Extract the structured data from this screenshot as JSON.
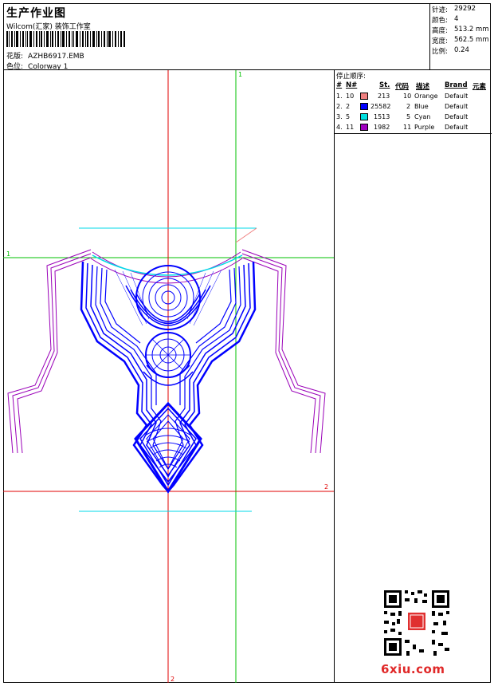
{
  "header": {
    "title": "生产作业图",
    "company": "Wilcom(汇家) 装饰工作室",
    "design_label": "花版:",
    "design_value": "AZHB6917.EMB",
    "colorway_label": "色位:",
    "colorway_value": "Colorway 1"
  },
  "stats": [
    {
      "label": "针迹:",
      "value": "29292"
    },
    {
      "label": "颜色:",
      "value": "4"
    },
    {
      "label": "高度:",
      "value": "513.2 mm"
    },
    {
      "label": "宽度:",
      "value": "562.5 mm"
    },
    {
      "label": "比例:",
      "value": "0.24"
    }
  ],
  "stop_sequence": {
    "title": "停止顺序:",
    "columns": [
      "#",
      "N#",
      "St.",
      "代码",
      "描述",
      "Brand",
      "元素"
    ],
    "rows": [
      {
        "num": "1.",
        "n": "10",
        "color": "#f08080",
        "st": "213",
        "code": "10",
        "desc": "Orange",
        "brand": "Default"
      },
      {
        "num": "2.",
        "n": "2",
        "color": "#0000ff",
        "st": "25582",
        "code": "2",
        "desc": "Blue",
        "brand": "Default"
      },
      {
        "num": "3.",
        "n": "5",
        "color": "#00e0e0",
        "st": "1513",
        "code": "5",
        "desc": "Cyan",
        "brand": "Default"
      },
      {
        "num": "4.",
        "n": "11",
        "color": "#a000c0",
        "st": "1982",
        "code": "11",
        "desc": "Purple",
        "brand": "Default"
      }
    ]
  },
  "guides": {
    "green_label_top": "1",
    "green_label_left": "1",
    "red_label_right": "2",
    "red_label_bottom": "2"
  },
  "watermark": "6xiu.com",
  "colors": {
    "blue": "#0000ff",
    "purple": "#9a00b8",
    "cyan": "#00d8e8",
    "red": "#e00000",
    "green": "#00c000",
    "accent": "#e02828"
  }
}
